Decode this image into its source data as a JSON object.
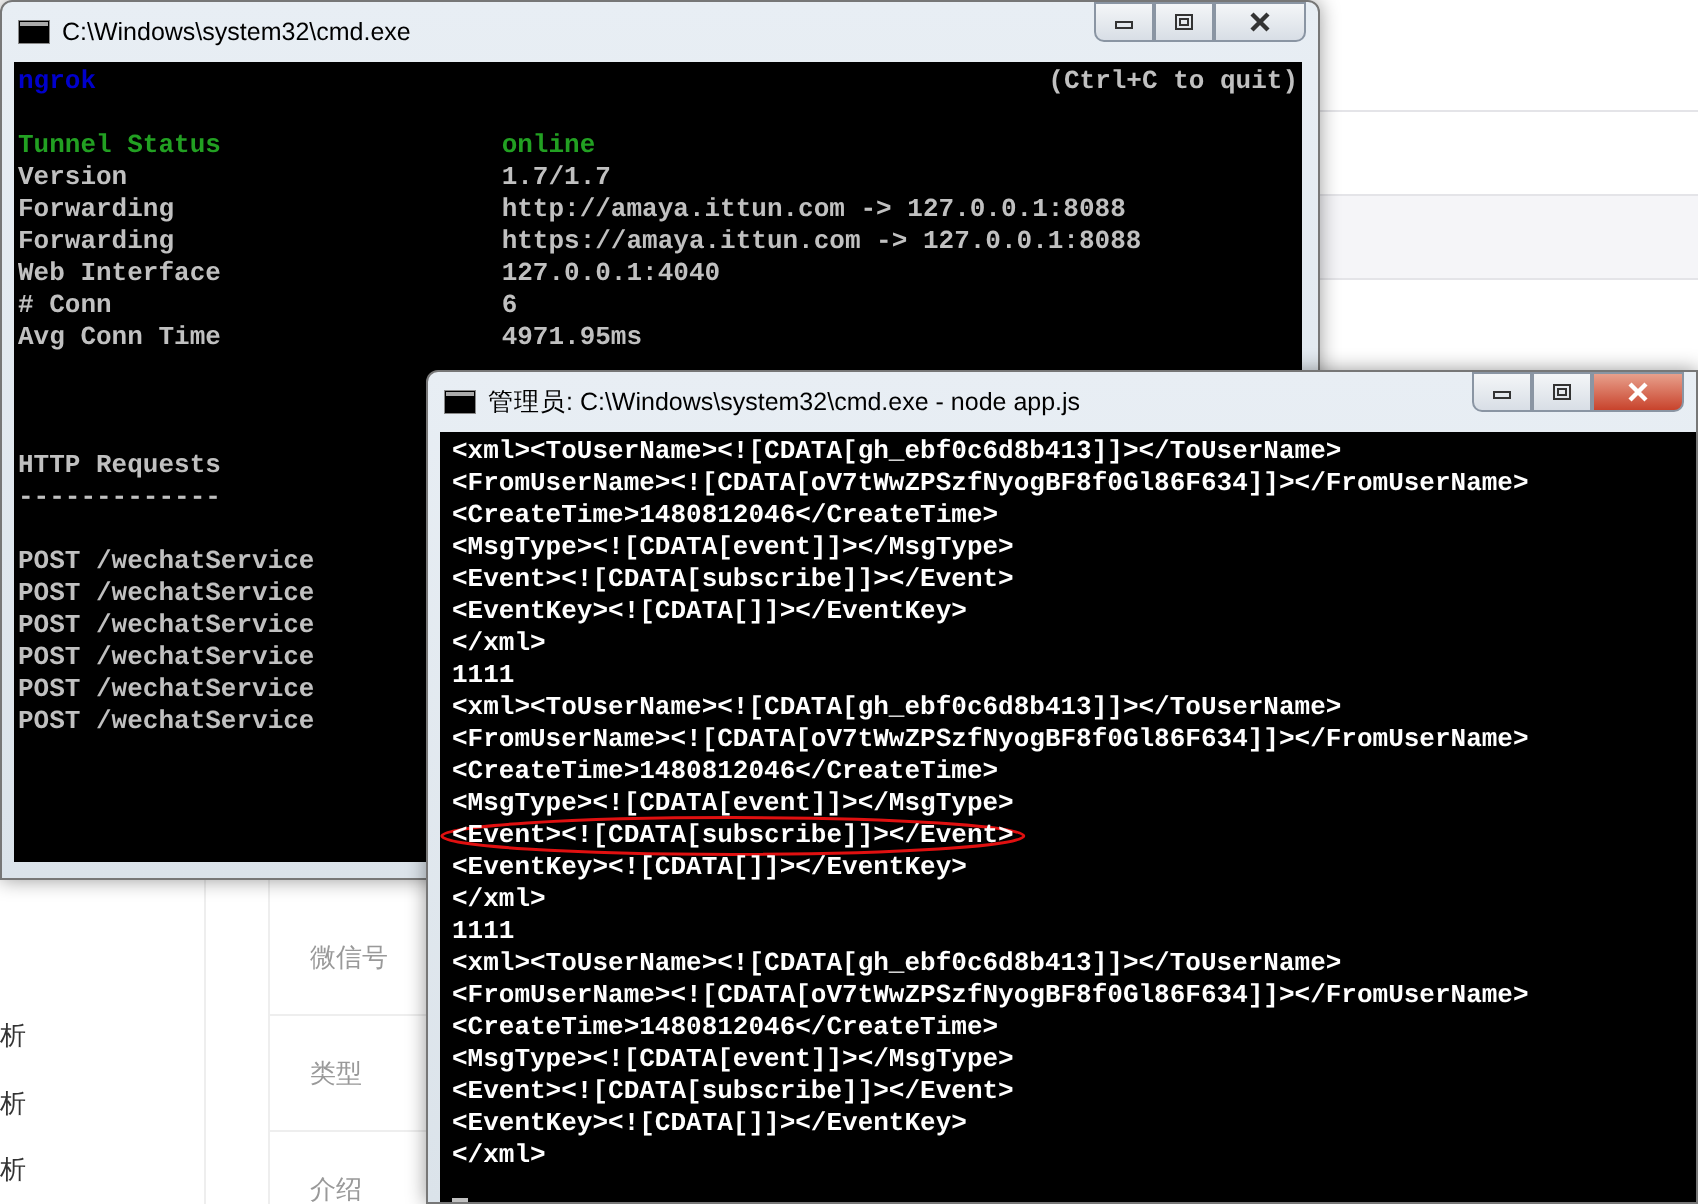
{
  "background_page": {
    "left_items": [
      "析",
      "析",
      "析"
    ],
    "field_labels": [
      "微信号",
      "类型",
      "介绍"
    ]
  },
  "windows": [
    {
      "title": "C:\\Windows\\system32\\cmd.exe",
      "active": false,
      "header": {
        "app": "ngrok",
        "hint": "(Ctrl+C to quit)"
      },
      "status_rows": [
        {
          "label": "Tunnel Status",
          "value": "online",
          "kind": "status"
        },
        {
          "label": "Version",
          "value": "1.7/1.7",
          "kind": "plain"
        },
        {
          "label": "Forwarding",
          "value": "http://amaya.ittun.com -> 127.0.0.1:8088",
          "kind": "plain"
        },
        {
          "label": "Forwarding",
          "value": "https://amaya.ittun.com -> 127.0.0.1:8088",
          "kind": "plain"
        },
        {
          "label": "Web Interface",
          "value": "127.0.0.1:4040",
          "kind": "plain"
        },
        {
          "label": "# Conn",
          "value": "6",
          "kind": "plain"
        },
        {
          "label": "Avg Conn Time",
          "value": "4971.95ms",
          "kind": "plain"
        }
      ],
      "requests_heading": "HTTP Requests",
      "requests_rule": "-------------",
      "requests": [
        "POST /wechatService",
        "POST /wechatService",
        "POST /wechatService",
        "POST /wechatService",
        "POST /wechatService",
        "POST /wechatService"
      ]
    },
    {
      "title": "管理员: C:\\Windows\\system32\\cmd.exe - node  app.js",
      "active": true,
      "output_lines": [
        {
          "text": "<xml><ToUserName><![CDATA[gh_ebf0c6d8b413]]></ToUserName>",
          "circled": false
        },
        {
          "text": "<FromUserName><![CDATA[oV7tWwZPSzfNyogBF8f0Gl86F634]]></FromUserName>",
          "circled": false
        },
        {
          "text": "<CreateTime>1480812046</CreateTime>",
          "circled": false
        },
        {
          "text": "<MsgType><![CDATA[event]]></MsgType>",
          "circled": false
        },
        {
          "text": "<Event><![CDATA[subscribe]]></Event>",
          "circled": false
        },
        {
          "text": "<EventKey><![CDATA[]]></EventKey>",
          "circled": false
        },
        {
          "text": "</xml>",
          "circled": false
        },
        {
          "text": "1111",
          "circled": false
        },
        {
          "text": "<xml><ToUserName><![CDATA[gh_ebf0c6d8b413]]></ToUserName>",
          "circled": false
        },
        {
          "text": "<FromUserName><![CDATA[oV7tWwZPSzfNyogBF8f0Gl86F634]]></FromUserName>",
          "circled": false
        },
        {
          "text": "<CreateTime>1480812046</CreateTime>",
          "circled": false
        },
        {
          "text": "<MsgType><![CDATA[event]]></MsgType>",
          "circled": false
        },
        {
          "text": "<Event><![CDATA[subscribe]]></Event>",
          "circled": true
        },
        {
          "text": "<EventKey><![CDATA[]]></EventKey>",
          "circled": false
        },
        {
          "text": "</xml>",
          "circled": false
        },
        {
          "text": "1111",
          "circled": false
        },
        {
          "text": "<xml><ToUserName><![CDATA[gh_ebf0c6d8b413]]></ToUserName>",
          "circled": false
        },
        {
          "text": "<FromUserName><![CDATA[oV7tWwZPSzfNyogBF8f0Gl86F634]]></FromUserName>",
          "circled": false
        },
        {
          "text": "<CreateTime>1480812046</CreateTime>",
          "circled": false
        },
        {
          "text": "<MsgType><![CDATA[event]]></MsgType>",
          "circled": false
        },
        {
          "text": "<Event><![CDATA[subscribe]]></Event>",
          "circled": false
        },
        {
          "text": "<EventKey><![CDATA[]]></EventKey>",
          "circled": false
        },
        {
          "text": "</xml>",
          "circled": false
        }
      ]
    }
  ]
}
